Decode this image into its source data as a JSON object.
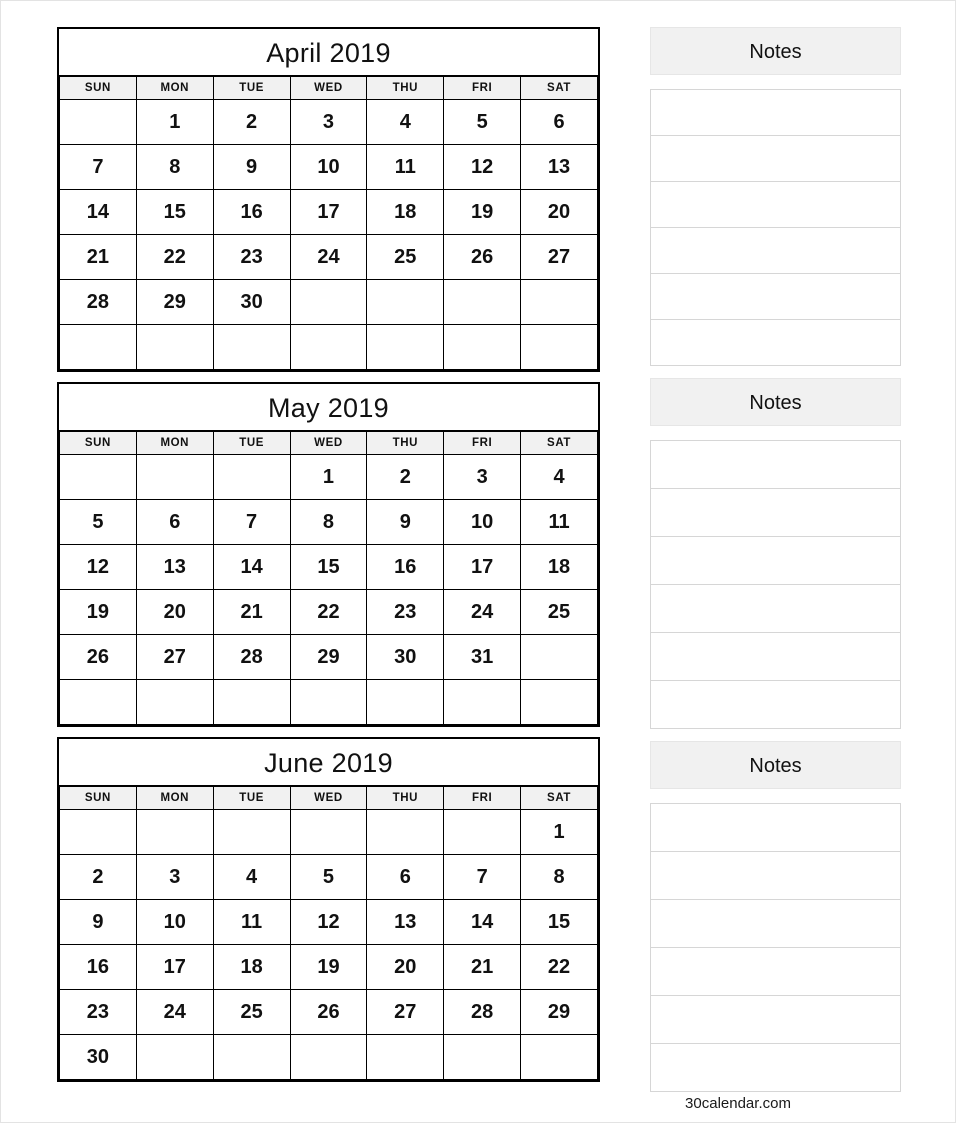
{
  "page": {
    "footer_credit": "30calendar.com",
    "accent_header_bg": "#f1f1f1",
    "grid_line_color": "#000000",
    "notes_line_color": "#d6d6d6"
  },
  "weekday_headers": [
    "SUN",
    "MON",
    "TUE",
    "WED",
    "THU",
    "FRI",
    "SAT"
  ],
  "months": [
    {
      "title": "April 2019",
      "weeks": [
        [
          "",
          "1",
          "2",
          "3",
          "4",
          "5",
          "6"
        ],
        [
          "7",
          "8",
          "9",
          "10",
          "11",
          "12",
          "13"
        ],
        [
          "14",
          "15",
          "16",
          "17",
          "18",
          "19",
          "20"
        ],
        [
          "21",
          "22",
          "23",
          "24",
          "25",
          "26",
          "27"
        ],
        [
          "28",
          "29",
          "30",
          "",
          "",
          "",
          ""
        ],
        [
          "",
          "",
          "",
          "",
          "",
          "",
          ""
        ]
      ]
    },
    {
      "title": "May 2019",
      "weeks": [
        [
          "",
          "",
          "",
          "1",
          "2",
          "3",
          "4"
        ],
        [
          "5",
          "6",
          "7",
          "8",
          "9",
          "10",
          "11"
        ],
        [
          "12",
          "13",
          "14",
          "15",
          "16",
          "17",
          "18"
        ],
        [
          "19",
          "20",
          "21",
          "22",
          "23",
          "24",
          "25"
        ],
        [
          "26",
          "27",
          "28",
          "29",
          "30",
          "31",
          ""
        ],
        [
          "",
          "",
          "",
          "",
          "",
          "",
          ""
        ]
      ]
    },
    {
      "title": "June 2019",
      "weeks": [
        [
          "",
          "",
          "",
          "",
          "",
          "",
          "1"
        ],
        [
          "2",
          "3",
          "4",
          "5",
          "6",
          "7",
          "8"
        ],
        [
          "9",
          "10",
          "11",
          "12",
          "13",
          "14",
          "15"
        ],
        [
          "16",
          "17",
          "18",
          "19",
          "20",
          "21",
          "22"
        ],
        [
          "23",
          "24",
          "25",
          "26",
          "27",
          "28",
          "29"
        ],
        [
          "30",
          "",
          "",
          "",
          "",
          "",
          ""
        ]
      ]
    }
  ],
  "notes_sections": [
    {
      "title": "Notes",
      "line_count": 6
    },
    {
      "title": "Notes",
      "line_count": 6
    },
    {
      "title": "Notes",
      "line_count": 6
    }
  ]
}
